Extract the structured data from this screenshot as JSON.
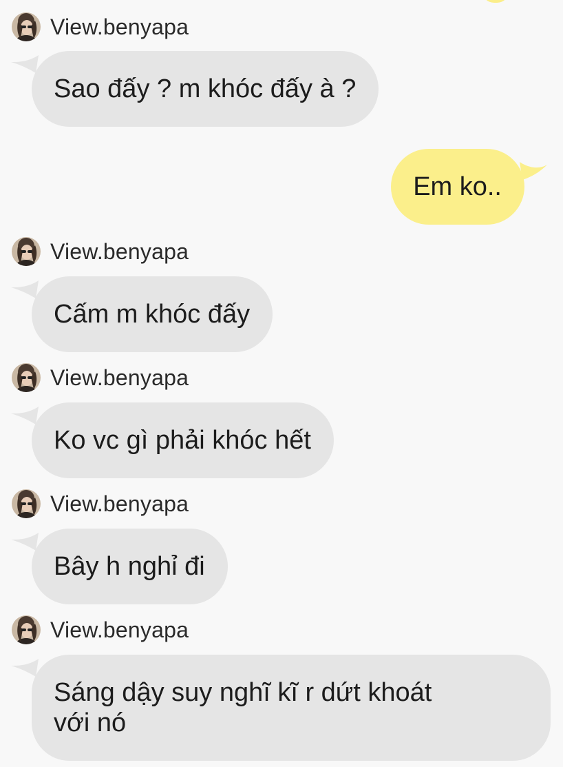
{
  "thread": {
    "messages": [
      {
        "direction": "incoming",
        "sender": "View.benyapa",
        "text": "Sao đấy ? m khóc đấy à ?"
      },
      {
        "direction": "outgoing",
        "text": "Em ko.."
      },
      {
        "direction": "incoming",
        "sender": "View.benyapa",
        "text": "Cấm m khóc đấy"
      },
      {
        "direction": "incoming",
        "sender": "View.benyapa",
        "text": "Ko vc gì phải khóc hết"
      },
      {
        "direction": "incoming",
        "sender": "View.benyapa",
        "text": "Bây h nghỉ đi"
      },
      {
        "direction": "incoming",
        "sender": "View.benyapa",
        "text": "Sáng dậy suy nghĩ kĩ r dứt khoát\nvới nó"
      }
    ]
  },
  "theme": {
    "background": "#f8f8f8",
    "incoming_bubble": "#e5e5e5",
    "outgoing_bubble": "#fbef8b"
  },
  "icons": {
    "avatar": "user-avatar-photo"
  }
}
